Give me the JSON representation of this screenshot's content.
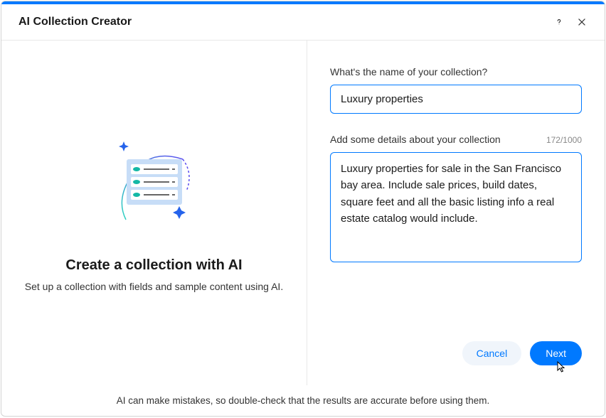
{
  "header": {
    "title": "AI Collection Creator"
  },
  "left": {
    "title": "Create a collection with AI",
    "subtitle": "Set up a collection with fields and sample content using AI."
  },
  "form": {
    "name_label": "What's the name of your collection?",
    "name_value": "Luxury properties",
    "details_label": "Add some details about your collection",
    "details_char_count": "172/1000",
    "details_value": "Luxury properties for sale in the San Francisco bay area. Include sale prices, build dates, square feet and all the basic listing info a real estate catalog would include."
  },
  "actions": {
    "cancel": "Cancel",
    "next": "Next"
  },
  "footer": {
    "disclaimer": "AI can make mistakes, so double-check that the results are accurate before using them."
  }
}
